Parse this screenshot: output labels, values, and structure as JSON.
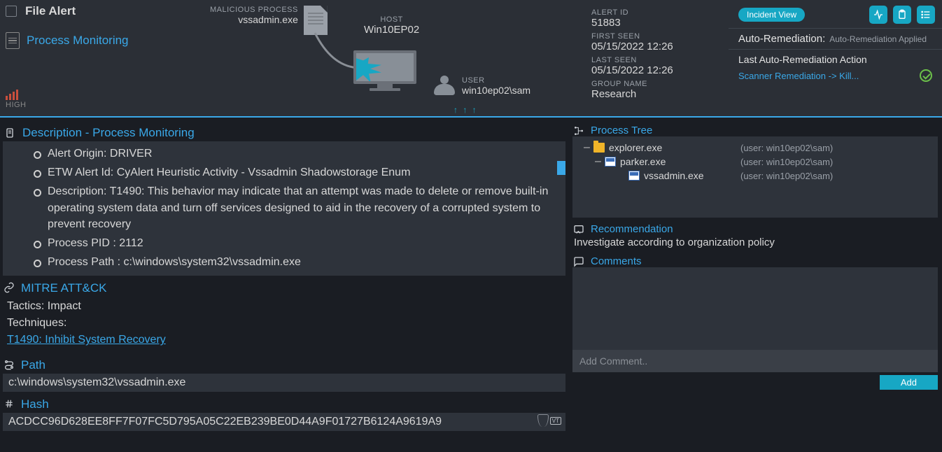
{
  "header": {
    "title": "File Alert",
    "subtitle": "Process Monitoring",
    "severity": "HIGH",
    "malicious_process": {
      "label": "MALICIOUS PROCESS",
      "value": "vssadmin.exe"
    },
    "host": {
      "label": "HOST",
      "value": "Win10EP02"
    },
    "user": {
      "label": "USER",
      "value": "win10ep02\\sam"
    },
    "arrows_down": "↑ ↑ ↑"
  },
  "meta": {
    "alert_id_label": "ALERT ID",
    "alert_id": "51883",
    "first_seen_label": "FIRST SEEN",
    "first_seen": "05/15/2022 12:26",
    "last_seen_label": "LAST SEEN",
    "last_seen": "05/15/2022 12:26",
    "group_label": "GROUP NAME",
    "group": "Research"
  },
  "actions": {
    "incident_view": "Incident View",
    "auto_remediation_label": "Auto-Remediation:",
    "auto_remediation_value": "Auto-Remediation Applied",
    "last_action_label": "Last Auto-Remediation Action",
    "last_action_link": "Scanner Remediation -> Kill..."
  },
  "description": {
    "title": "Description - Process Monitoring",
    "items": [
      "Alert Origin: DRIVER",
      "ETW Alert Id: CyAlert Heuristic Activity - Vssadmin Shadowstorage Enum",
      "Description: T1490: This behavior may indicate that an attempt was made to delete or remove built-in operating system data and turn off services designed to aid in the recovery of a corrupted system to prevent recovery",
      "Process PID : 2112",
      "Process Path : c:\\windows\\system32\\vssadmin.exe"
    ]
  },
  "mitre": {
    "title": "MITRE ATT&CK",
    "tactics": "Tactics: Impact",
    "techniques_label": "Techniques:",
    "technique_link": "T1490: Inhibit System Recovery"
  },
  "path": {
    "title": "Path",
    "value": "c:\\windows\\system32\\vssadmin.exe"
  },
  "hash": {
    "title": "Hash",
    "value": "ACDCC96D628EE8FF7F07FC5D795A05C22EB239BE0D44A9F01727B6124A9619A9",
    "vt": "VT"
  },
  "process_tree": {
    "title": "Process Tree",
    "rows": [
      {
        "indent": 1,
        "toggle": "–",
        "icon": "folder",
        "name": "explorer.exe",
        "user": "(user: win10ep02\\sam)"
      },
      {
        "indent": 2,
        "toggle": "–",
        "icon": "proc",
        "name": "parker.exe",
        "user": "(user: win10ep02\\sam)"
      },
      {
        "indent": 3,
        "toggle": "",
        "icon": "proc",
        "name": "vssadmin.exe",
        "user": "(user: win10ep02\\sam)"
      }
    ]
  },
  "recommendation": {
    "title": "Recommendation",
    "text": "Investigate according to organization policy"
  },
  "comments": {
    "title": "Comments",
    "placeholder": "Add Comment..",
    "add": "Add"
  }
}
